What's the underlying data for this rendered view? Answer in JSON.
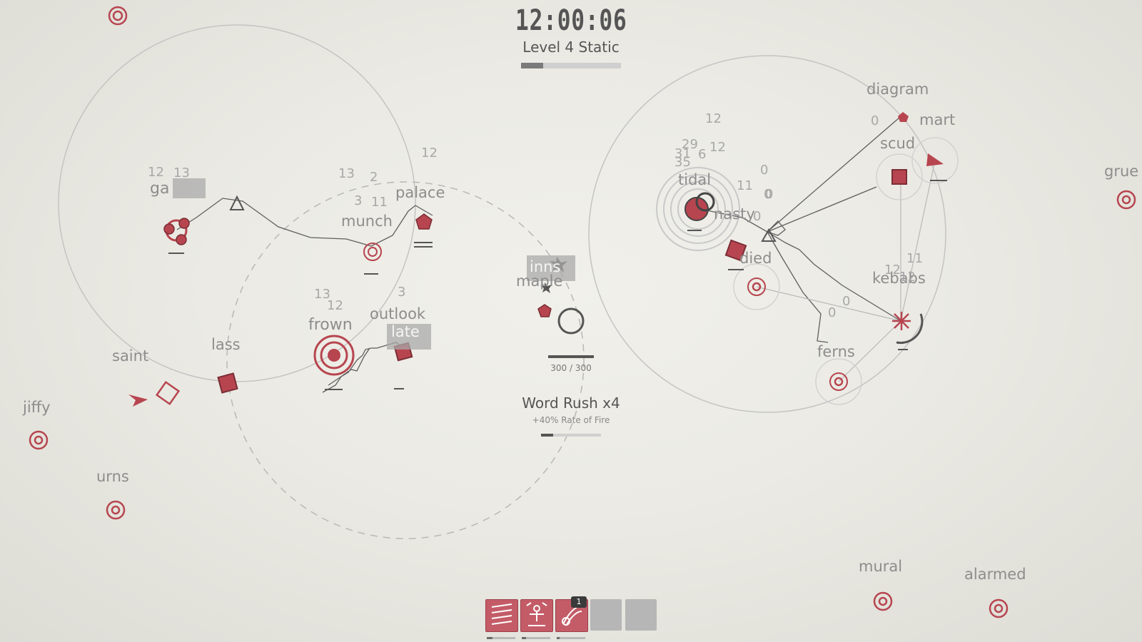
{
  "hud": {
    "clock": "12:00:06",
    "level_label": "Level 4 Static",
    "level_progress": 0.22
  },
  "core": {
    "hp_text": "300 / 300",
    "hp_fraction": 1.0,
    "bonus_title": "Word Rush x4",
    "bonus_detail": "+40% Rate of Fire",
    "bonus_progress": 0.2
  },
  "words": {
    "ga": "ga",
    "munch": "munch",
    "palace": "palace",
    "frown": "frown",
    "outlook": "outlook",
    "late": "late",
    "lass": "lass",
    "saint": "saint",
    "jiffy": "jiffy",
    "urns": "urns",
    "inns": "inns",
    "maple": "maple",
    "diagram": "diagram",
    "mart": "mart",
    "scud": "scud",
    "tidal": "tidal",
    "nasty": "nasty",
    "died": "died",
    "kebabs": "kebabs",
    "ferns": "ferns",
    "grue": "grue",
    "mural": "mural",
    "alarmed": "alarmed"
  },
  "damage_numbers": [
    "13",
    "12",
    "13",
    "2",
    "3",
    "11",
    "12",
    "13",
    "12",
    "3",
    "12",
    "29",
    "31",
    "6",
    "12",
    "35",
    "0",
    "11",
    "0",
    "0",
    "0",
    "0",
    "12",
    "11",
    "0",
    "0",
    "12"
  ],
  "hotbar": {
    "slots": [
      {
        "name": "ability-1",
        "state": "active"
      },
      {
        "name": "ability-2",
        "state": "active"
      },
      {
        "name": "ability-3",
        "state": "active",
        "badge": "1"
      },
      {
        "name": "ability-4",
        "state": "empty"
      },
      {
        "name": "ability-5",
        "state": "empty"
      }
    ]
  },
  "colors": {
    "accent": "#b7454f",
    "ink": "#555555",
    "word": "#8d8d8d",
    "line": "#606060"
  }
}
